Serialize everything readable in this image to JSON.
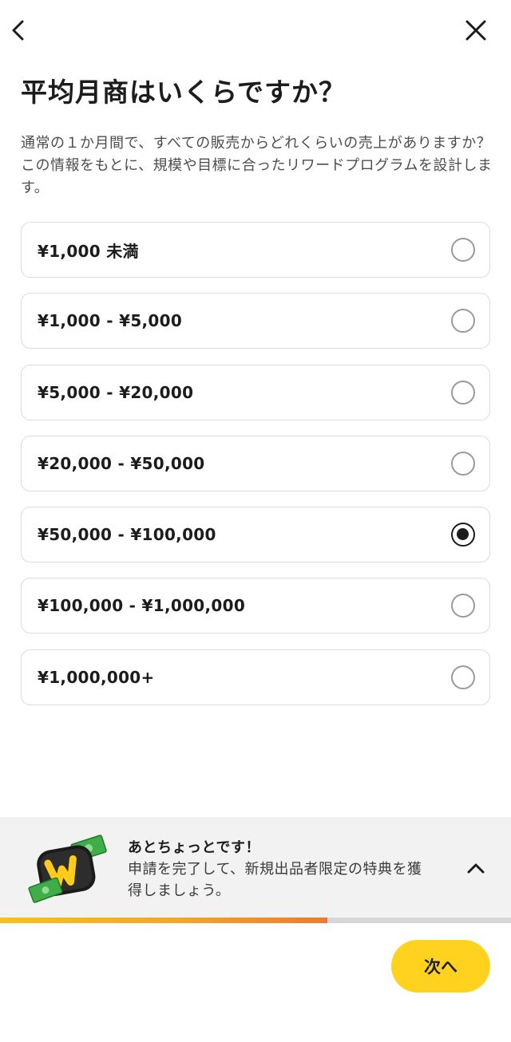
{
  "header": {
    "back_icon": "chevron-left-icon",
    "close_icon": "close-icon"
  },
  "title": "平均月商はいくらですか？",
  "description": "通常の１か月間で、すべての販売からどれくらいの売上がありますか？この情報をもとに、規模や目標に合ったリワードプログラムを設計します。",
  "options": [
    {
      "label": "¥1,000 未満",
      "selected": false
    },
    {
      "label": "¥1,000 - ¥5,000",
      "selected": false
    },
    {
      "label": "¥5,000 - ¥20,000",
      "selected": false
    },
    {
      "label": "¥20,000 - ¥50,000",
      "selected": false
    },
    {
      "label": "¥50,000 - ¥100,000",
      "selected": true
    },
    {
      "label": "¥100,000 - ¥1,000,000",
      "selected": false
    },
    {
      "label": "¥1,000,000+",
      "selected": false
    }
  ],
  "promo": {
    "title": "あとちょっとです！",
    "text": "申請を完了して、新規出品者限定の特典を獲得しましょう。",
    "icon": "wallet-money-icon",
    "toggle_icon": "chevron-up-icon"
  },
  "progress": {
    "fraction": 0.64
  },
  "colors": {
    "accent": "#ffd21f",
    "progress_start": "#f6c21a",
    "progress_end": "#ee7a2e"
  },
  "footer": {
    "next_label": "次へ"
  }
}
